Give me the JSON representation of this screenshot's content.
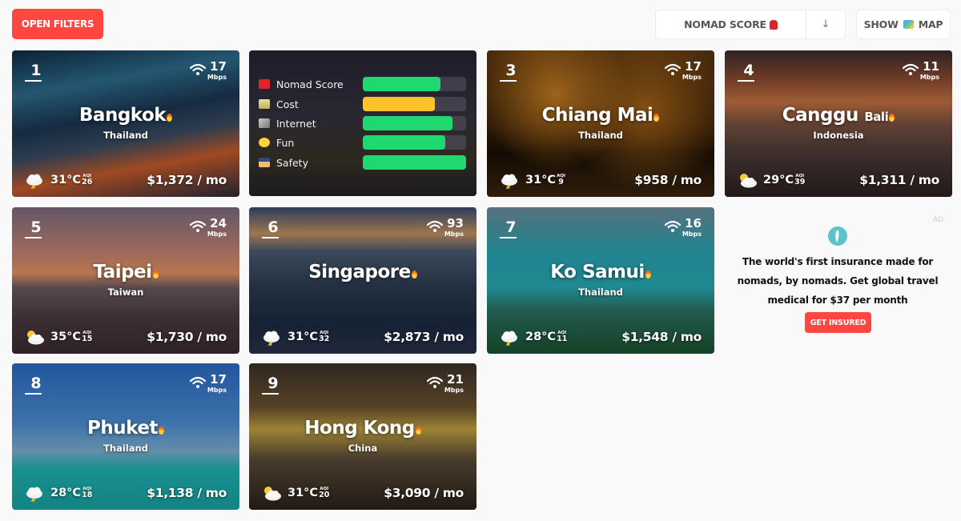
{
  "toolbar": {
    "open_filters_label": "OPEN FILTERS",
    "sort_label": "NOMAD SCORE",
    "sort_icon": "backpack-icon",
    "sort_direction": "↓",
    "show_map_label_1": "SHOW",
    "show_map_icon": "map-icon",
    "show_map_label_2": "MAP"
  },
  "score_card": {
    "rows": [
      {
        "label": "Nomad Score",
        "icon": "backpack-icon",
        "value": 0.75,
        "color": "#1fd86f"
      },
      {
        "label": "Cost",
        "icon": "money-icon",
        "value": 0.7,
        "color": "#fec32b"
      },
      {
        "label": "Internet",
        "icon": "satellite-icon",
        "value": 0.87,
        "color": "#1fd86f"
      },
      {
        "label": "Fun",
        "icon": "smiley-icon",
        "value": 0.8,
        "color": "#1fd86f"
      },
      {
        "label": "Safety",
        "icon": "police-icon",
        "value": 1.0,
        "color": "#1fd86f"
      }
    ]
  },
  "cities": [
    {
      "rank": "1",
      "city": "Bangkok",
      "sub": "",
      "country": "Thailand",
      "wifi": "17",
      "wifi_unit": "Mbps",
      "temp": "31°C",
      "aqi_label": "AQI",
      "aqi": "26",
      "weather": "storm",
      "price": "$1,372 / mo"
    },
    {
      "rank": "3",
      "city": "Chiang Mai",
      "sub": "",
      "country": "Thailand",
      "wifi": "17",
      "wifi_unit": "Mbps",
      "temp": "31°C",
      "aqi_label": "AQI",
      "aqi": "9",
      "weather": "storm",
      "price": "$958 / mo"
    },
    {
      "rank": "4",
      "city": "Canggu",
      "sub": "Bali",
      "country": "Indonesia",
      "wifi": "11",
      "wifi_unit": "Mbps",
      "temp": "29°C",
      "aqi_label": "AQI",
      "aqi": "39",
      "weather": "partly-sunny",
      "price": "$1,311 / mo"
    },
    {
      "rank": "5",
      "city": "Taipei",
      "sub": "",
      "country": "Taiwan",
      "wifi": "24",
      "wifi_unit": "Mbps",
      "temp": "35°C",
      "aqi_label": "AQI",
      "aqi": "15",
      "weather": "partly-sunny",
      "price": "$1,730 / mo"
    },
    {
      "rank": "6",
      "city": "Singapore",
      "sub": "",
      "country": "",
      "wifi": "93",
      "wifi_unit": "Mbps",
      "temp": "31°C",
      "aqi_label": "AQI",
      "aqi": "32",
      "weather": "storm",
      "price": "$2,873 / mo"
    },
    {
      "rank": "7",
      "city": "Ko Samui",
      "sub": "",
      "country": "Thailand",
      "wifi": "16",
      "wifi_unit": "Mbps",
      "temp": "28°C",
      "aqi_label": "AQI",
      "aqi": "11",
      "weather": "storm",
      "price": "$1,548 / mo"
    },
    {
      "rank": "8",
      "city": "Phuket",
      "sub": "",
      "country": "Thailand",
      "wifi": "17",
      "wifi_unit": "Mbps",
      "temp": "28°C",
      "aqi_label": "AQI",
      "aqi": "18",
      "weather": "storm",
      "price": "$1,138 / mo"
    },
    {
      "rank": "9",
      "city": "Hong Kong",
      "sub": "",
      "country": "China",
      "wifi": "21",
      "wifi_unit": "Mbps",
      "temp": "31°C",
      "aqi_label": "AQI",
      "aqi": "20",
      "weather": "partly-sunny",
      "price": "$3,090 / mo"
    }
  ],
  "ad": {
    "tag": "AD",
    "text": "The world's first insurance made for nomads, by nomads. Get global travel medical for $37 per month",
    "button_label": "GET INSURED"
  }
}
